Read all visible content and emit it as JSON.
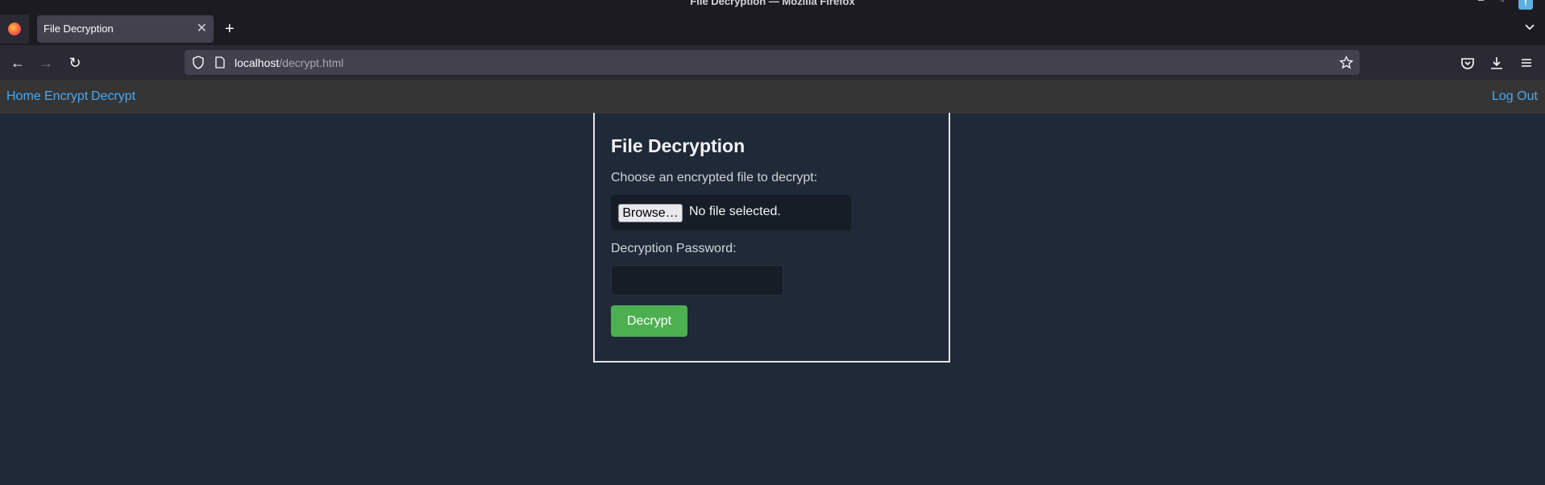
{
  "window": {
    "title": "File Decryption — Mozilla Firefox"
  },
  "browser": {
    "tab_title": "File Decryption",
    "url_host": "localhost",
    "url_path": "/decrypt.html"
  },
  "nav": {
    "home": "Home",
    "encrypt": "Encrypt",
    "decrypt": "Decrypt",
    "logout": "Log Out"
  },
  "form": {
    "title": "File Decryption",
    "file_label": "Choose an encrypted file to decrypt:",
    "browse_label": "Browse…",
    "file_status": "No file selected.",
    "password_label": "Decryption Password:",
    "password_value": "",
    "submit_label": "Decrypt"
  },
  "colors": {
    "page_bg": "#1f2937",
    "nav_bg": "#353535",
    "link": "#4aa8f0",
    "button": "#4caf50"
  }
}
